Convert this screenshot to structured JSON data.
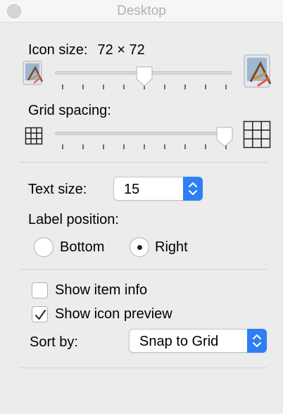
{
  "window": {
    "title": "Desktop"
  },
  "icon_size": {
    "label": "Icon size:",
    "value": "72 × 72",
    "slider_level": 0.5
  },
  "grid_spacing": {
    "label": "Grid spacing:",
    "slider_level": 1.0
  },
  "text_size": {
    "label": "Text size:",
    "value": "15"
  },
  "label_position": {
    "label": "Label position:",
    "options": [
      {
        "label": "Bottom",
        "selected": false
      },
      {
        "label": "Right",
        "selected": true
      }
    ]
  },
  "show_item_info": {
    "label": "Show item info",
    "checked": false
  },
  "show_icon_preview": {
    "label": "Show icon preview",
    "checked": true
  },
  "sort_by": {
    "label": "Sort by:",
    "value": "Snap to Grid"
  },
  "colors": {
    "accent": "#2f7ff4",
    "window_bg": "#ececec",
    "title_text": "#b0b0b0"
  }
}
